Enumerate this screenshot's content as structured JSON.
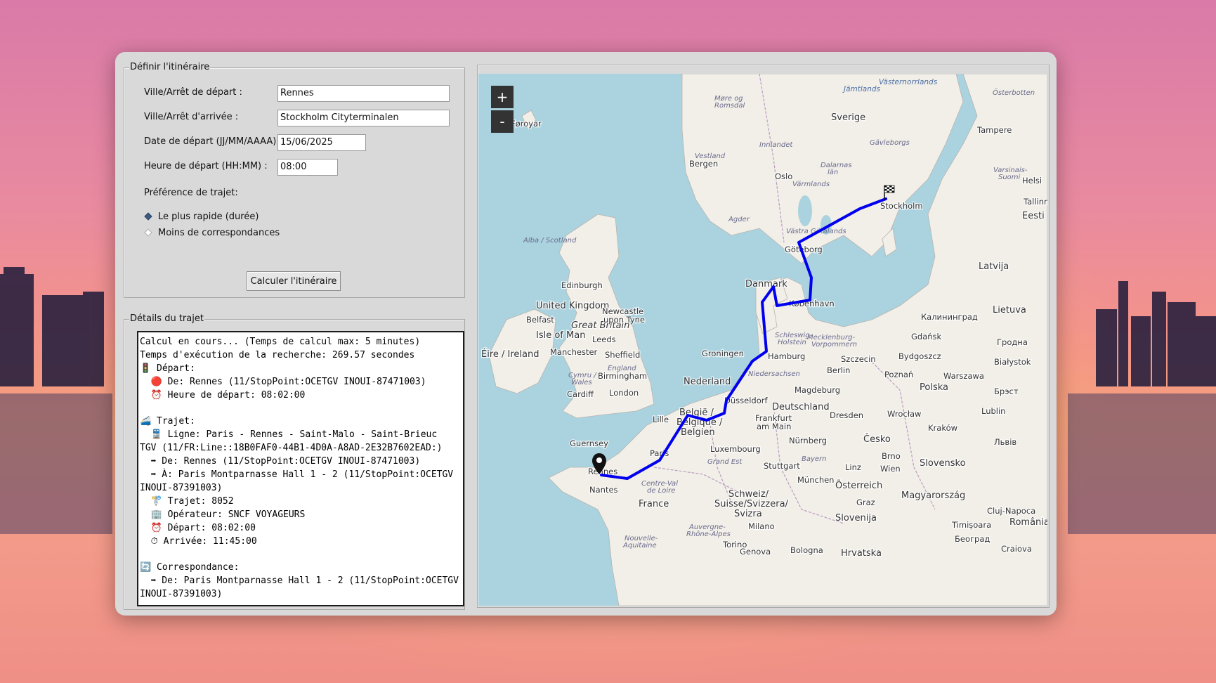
{
  "app": {
    "route_group_title": "Définir l'itinéraire",
    "details_group_title": "Détails du trajet"
  },
  "form": {
    "departure_label": "Ville/Arrêt de départ :",
    "departure_value": "Rennes",
    "arrival_label": "Ville/Arrêt d'arrivée :",
    "arrival_value": "Stockholm Cityterminalen",
    "date_label": "Date de départ (JJ/MM/AAAA) :",
    "date_value": "15/06/2025",
    "time_label": "Heure de départ (HH:MM) :",
    "time_value": "08:00",
    "preference_label": "Préférence de trajet:",
    "options": [
      {
        "label": "Le plus rapide (durée)",
        "selected": true
      },
      {
        "label": "Moins de correspondances",
        "selected": false
      }
    ],
    "calculate_button": "Calculer l'itinéraire"
  },
  "details": {
    "lines": [
      "Calcul en cours... (Temps de calcul max: 5 minutes)",
      "Temps d'exécution de la recherche: 269.57 secondes",
      "🚦 Départ:",
      "  🔴 De: Rennes (11/StopPoint:OCETGV INOUI-87471003)",
      "  ⏰ Heure de départ: 08:02:00",
      "",
      "🚄 Trajet:",
      "  🚆 Ligne: Paris - Rennes - Saint-Malo - Saint-Brieuc",
      "TGV (11/FR:Line::18B0FAF0-44B1-4D0A-A8AD-2E32B7602EAD:)",
      "  ➡ De: Rennes (11/StopPoint:OCETGV INOUI-87471003)",
      "  ➡ À: Paris Montparnasse Hall 1 - 2 (11/StopPoint:OCETGV",
      "INOUI-87391003)",
      "  🚏 Trajet: 8052",
      "  🏢 Opérateur: SNCF VOYAGEURS",
      "  ⏰ Départ: 08:02:00",
      "  ⏱ Arrivée: 11:45:00",
      "",
      "🔄 Correspondance:",
      "  ➡ De: Paris Montparnasse Hall 1 - 2 (11/StopPoint:OCETGV",
      "INOUI-87391003)"
    ]
  },
  "map": {
    "zoom_in": "+",
    "zoom_out": "-",
    "route_color": "#0000ee",
    "land_color": "#f2efe9",
    "sea_color": "#aad3df",
    "start_marker_icon": "map-pin-icon",
    "end_marker_icon": "checkered-flag-icon",
    "labels": {
      "sverige": "Sverige",
      "norge_city_oslo": "Oslo",
      "bergen": "Bergen",
      "stockholm": "Stockholm",
      "goteborg": "Göteborg",
      "kobenhavn": "København",
      "danmark": "Danmark",
      "tampere": "Tampere",
      "helsinki": "Helsi",
      "tallinn": "Tallinn",
      "eesti": "Eesti",
      "latvija": "Latvija",
      "lietuva": "Lietuva",
      "kaliningrad": "Калининград",
      "gdansk": "Gdańsk",
      "hrodna": "Гродна",
      "bialystok": "Białystok",
      "bydgoszcz": "Bydgoszcz",
      "szczecin": "Szczecin",
      "berlin": "Berlin",
      "poznan": "Poznań",
      "warszawa": "Warszawa",
      "polska": "Polska",
      "brest": "Брэст",
      "lublin": "Lublin",
      "wroclaw": "Wrocław",
      "krakow": "Kraków",
      "lviv": "Львів",
      "cesko": "Česko",
      "brno": "Brno",
      "wien": "Wien",
      "linz": "Linz",
      "slovensko": "Slovensko",
      "osterreich": "Österreich",
      "magyarorszag": "Magyarország",
      "graz": "Graz",
      "slovenija": "Slovenija",
      "cluj": "Cluj-Napoca",
      "romania": "România",
      "timisoara": "Timișoara",
      "beograd": "Београд",
      "craiova": "Craiova",
      "hrvatska": "Hrvatska",
      "bologna": "Bologna",
      "genova": "Genova",
      "torino": "Torino",
      "milano": "Milano",
      "munchen": "München",
      "stuttgart": "Stuttgart",
      "nurnberg": "Nürnberg",
      "frankfurt": "Frankfurt",
      "frankfurt2": "am Main",
      "deutschland": "Deutschland",
      "magdeburg": "Magdeburg",
      "dresden": "Dresden",
      "hamburg": "Hamburg",
      "groningen": "Groningen",
      "nederland": "Nederland",
      "dusseldorf": "Düsseldorf",
      "belgie": "België /",
      "belgique": "Belgique /",
      "belgien": "Belgien",
      "luxembourg": "Luxembourg",
      "lille": "Lille",
      "paris": "Paris",
      "france": "France",
      "nantes": "Nantes",
      "rennes": "Rennes",
      "guernsey": "Guernsey",
      "schweiz": "Schweiz/",
      "suisse": "Suisse/Svizzera/",
      "svizra": "Svizra",
      "london": "London",
      "cardiff": "Cardiff",
      "birmingham": "Birmingham",
      "manchester": "Manchester",
      "sheffield": "Sheffield",
      "leeds": "Leeds",
      "isle_of_man": "Isle of Man",
      "belfast": "Belfast",
      "eire": "Éire / Ireland",
      "united_kingdom": "United Kingdom",
      "great_britain": "Great Britain",
      "edinburgh": "Edinburgh",
      "newcastle": "Newcastle",
      "newcastle2": "upon Tyne",
      "foroyar": "Føroyar",
      "england": "England",
      "cymru": "Cymru /",
      "wales": "Wales",
      "alba": "Alba / Scotland",
      "vastra": "Västra Götalands",
      "schleswig": "Schleswig-",
      "holstein": "Holstein",
      "meckl": "Mecklenburg-",
      "vorpommern": "Vorpommern",
      "niedersachsen": "Niedersachsen",
      "bayern": "Bayern",
      "grand_est": "Grand Est",
      "centre": "Centre-Val",
      "centre2": "de Loire",
      "nouvelle": "Nouvelle-",
      "aquitaine": "Aquitaine",
      "auvergne": "Auvergne-",
      "rhone": "Rhône-Alpes",
      "agder": "Agder",
      "vestland": "Vestland",
      "innlandet": "Innlandet",
      "more": "Møre og",
      "romsdal": "Romsdal",
      "dalarnas": "Dalarnas",
      "lan": "län",
      "gavleborgs": "Gävleborgs",
      "varmlands": "Värmlands",
      "varsinais": "Varsinais-",
      "suomi": "Suomi",
      "osterbotten": "Österbotten",
      "vasternorr": "Västernorrlands",
      "jamtlands": "Jämtlands"
    }
  }
}
